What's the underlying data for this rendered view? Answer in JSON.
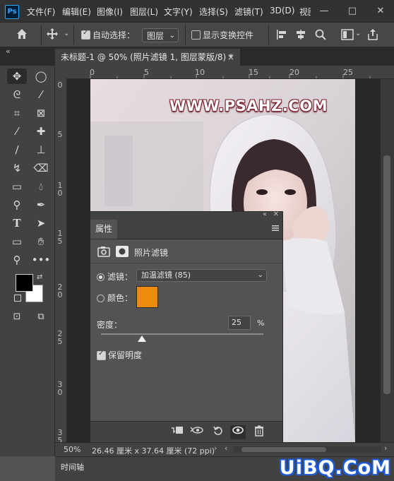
{
  "app": {
    "logo_text": "Ps"
  },
  "menu": [
    "文件(F)",
    "编辑(E)",
    "图像(I)",
    "图层(L)",
    "文字(Y)",
    "选择(S)",
    "滤镜(T)",
    "3D(D)",
    "视图"
  ],
  "window_buttons": [
    "—",
    "□",
    "✕"
  ],
  "options": {
    "auto_select_label": "自动选择：",
    "auto_select_checked": true,
    "auto_select_target": "图层",
    "show_transform_label": "显示变换控件",
    "show_transform_checked": false
  },
  "document": {
    "tab_title": "未标题-1 @ 50% (照片滤镜 1, 图层蒙版/8) *",
    "watermark_text": "WWW.PSAHZ.COM"
  },
  "ruler": {
    "top_labels": [
      "0",
      "5",
      "10",
      "15",
      "20",
      "25"
    ],
    "left_labels": [
      "0",
      "5",
      "1 0",
      "1 5",
      "2 0",
      "2 5",
      "3 0",
      "3 5"
    ]
  },
  "status": {
    "zoom": "50%",
    "doc_size": "26.46 厘米 x 37.64 厘米 (72 ppi)"
  },
  "timeline_label": "时间轴",
  "properties": {
    "tab_label": "属性",
    "header_title": "照片滤镜",
    "filter_label": "滤镜：",
    "filter_value": "加温滤镜 (85)",
    "filter_selected": true,
    "color_label": "颜色：",
    "color_swatch": "#ec8b0c",
    "density_label": "密度：",
    "density_value": "25",
    "density_unit": "%",
    "density_fraction": 0.25,
    "preserve_luminosity_label": "保留明度",
    "preserve_luminosity_checked": true
  },
  "colors": {
    "foreground": "#000000",
    "background": "#ffffff"
  },
  "site_watermark": "UiBQ.CoM"
}
